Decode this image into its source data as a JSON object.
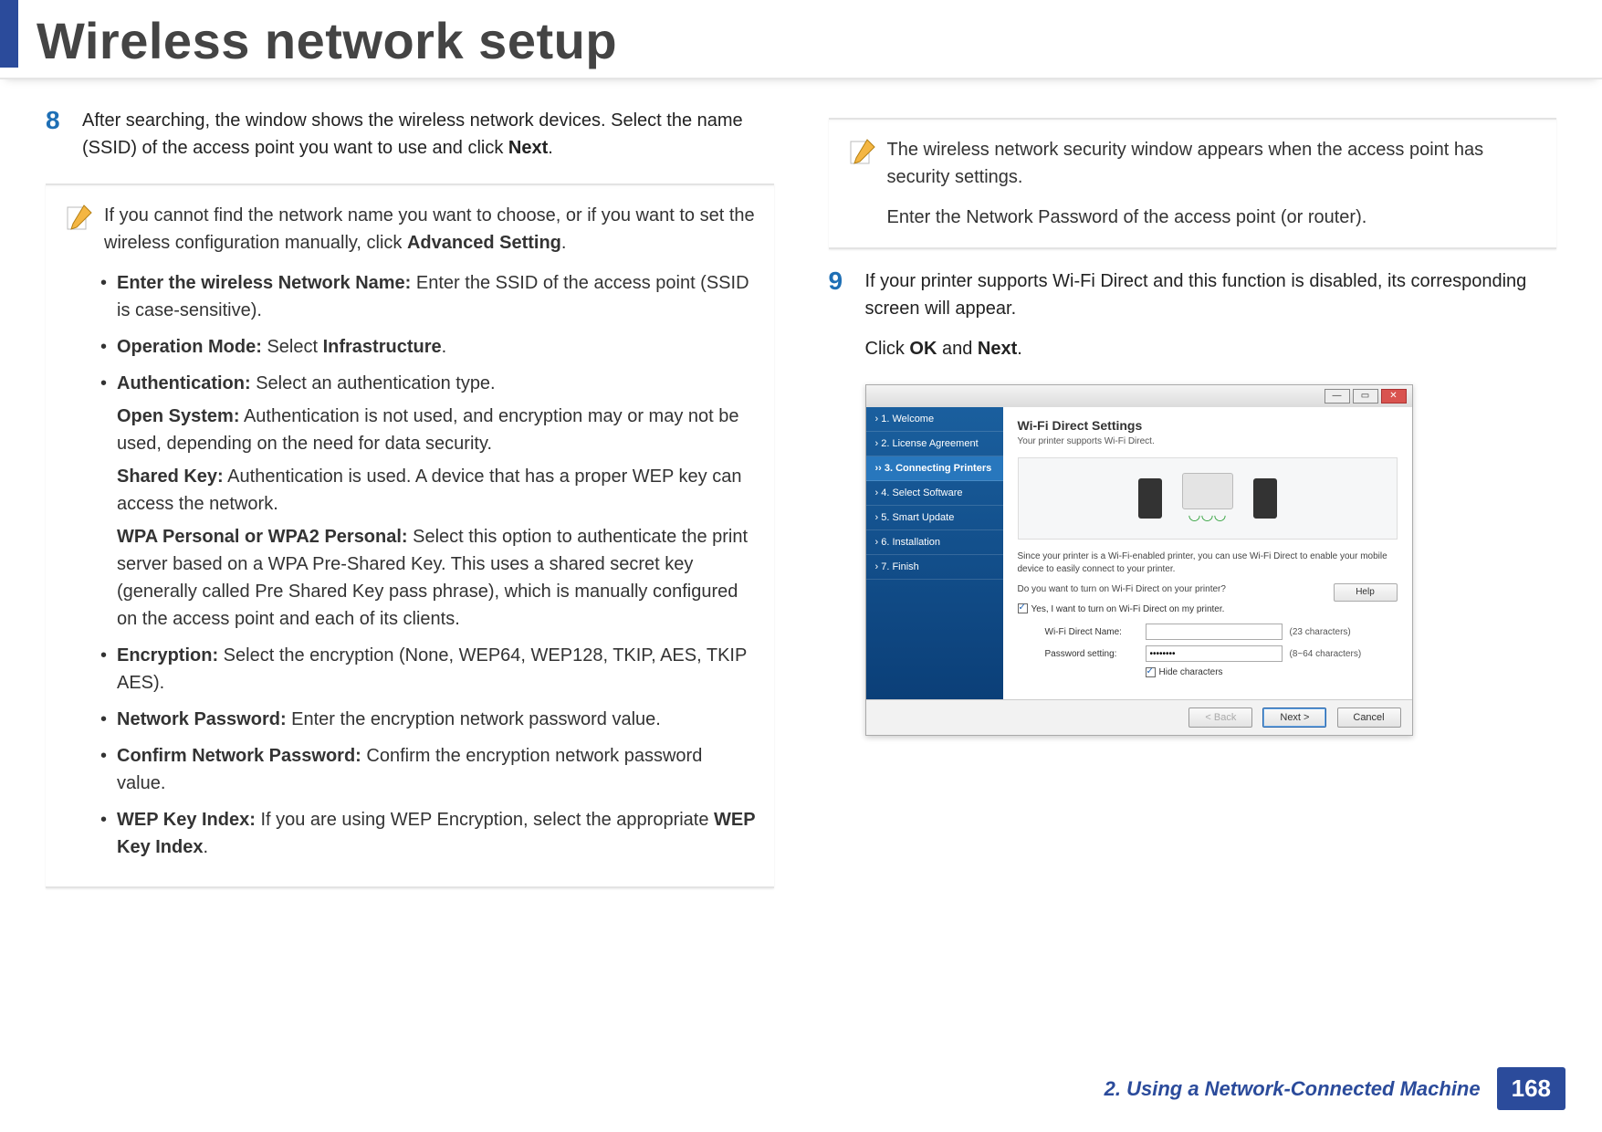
{
  "header": {
    "title": "Wireless network setup"
  },
  "step8": {
    "number": "8",
    "text_before_bold": "After searching, the window shows the wireless network devices. Select the name (SSID) of the access point you want to use and click ",
    "bold1": "Next",
    "text_after": "."
  },
  "note1": {
    "intro_before": "If you cannot find the network name you want to choose, or if you want to set the wireless configuration manually, click ",
    "intro_bold": "Advanced Setting",
    "intro_after": ".",
    "bullets": {
      "b1_label": "Enter the wireless Network Name:",
      "b1_text": " Enter the SSID of the access point (SSID is case-sensitive).",
      "b2_label": "Operation Mode:",
      "b2_text_before": " Select ",
      "b2_bold": "Infrastructure",
      "b2_after": ".",
      "b3_label": "Authentication:",
      "b3_text": " Select an authentication type.",
      "b3_open_label": "Open System:",
      "b3_open_text": " Authentication is not used, and encryption may or may not be used, depending on the need for data security.",
      "b3_shared_label": "Shared Key:",
      "b3_shared_text": " Authentication is used. A device that has a proper WEP key can access the network.",
      "b3_wpa_label": "WPA Personal or WPA2 Personal:",
      "b3_wpa_text": " Select this option to authenticate the print server based on a WPA Pre-Shared Key. This uses a shared secret key (generally called Pre Shared Key pass phrase), which is manually configured on the access point and each of its clients.",
      "b4_label": "Encryption:",
      "b4_text": " Select the encryption (None, WEP64, WEP128, TKIP, AES, TKIP AES).",
      "b5_label": "Network Password:",
      "b5_text": " Enter the encryption network password value.",
      "b6_label": "Confirm Network Password:",
      "b6_text": " Confirm the encryption network password value.",
      "b7_label": "WEP Key Index:",
      "b7_text_before": " If you are using WEP Encryption, select the appropriate ",
      "b7_bold": "WEP Key Index",
      "b7_after": "."
    }
  },
  "note2": {
    "line1": "The wireless network security window appears when the access point has security settings.",
    "line2": "Enter the Network Password of the access point (or router)."
  },
  "step9": {
    "number": "9",
    "line1": "If your printer supports Wi-Fi Direct and this function is disabled, its corresponding screen will appear.",
    "line2_before": "Click ",
    "line2_bold1": "OK",
    "line2_mid": " and ",
    "line2_bold2": "Next",
    "line2_after": "."
  },
  "installer": {
    "sidebar": {
      "s1": "› 1. Welcome",
      "s2": "› 2. License Agreement",
      "s3": "›› 3. Connecting Printers",
      "s4": "› 4. Select Software",
      "s5": "› 5. Smart Update",
      "s6": "› 6. Installation",
      "s7": "› 7. Finish"
    },
    "heading": "Wi-Fi Direct Settings",
    "subheading": "Your printer supports Wi-Fi Direct.",
    "desc": "Since your printer is a Wi-Fi-enabled printer, you can use Wi-Fi Direct to enable your mobile device to easily connect to your printer.",
    "question": "Do you want to turn on Wi-Fi Direct on your printer?",
    "help_label": "Help",
    "checkbox_label": "Yes, I want to turn on Wi-Fi Direct on my printer.",
    "field1_label": "Wi-Fi Direct Name:",
    "field1_hint": "(23 characters)",
    "field2_label": "Password setting:",
    "field2_value": "••••••••",
    "field2_hint": "(8~64 characters)",
    "hide_chars": "Hide characters",
    "btn_back": "< Back",
    "btn_next": "Next >",
    "btn_cancel": "Cancel"
  },
  "footer": {
    "chapter": "2.  Using a Network-Connected Machine",
    "page": "168"
  }
}
